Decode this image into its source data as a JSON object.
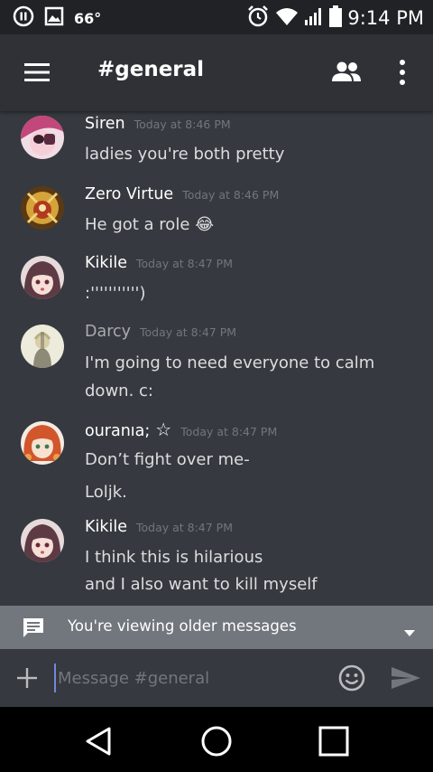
{
  "status_bar": {
    "temperature": "66°",
    "time": "9:14 PM",
    "icons": [
      "pause-icon",
      "gallery-icon",
      "alarm-icon",
      "wifi-icon",
      "signal-icon",
      "battery-icon"
    ]
  },
  "header": {
    "channel_name": "#general",
    "icons": [
      "hamburger-menu-icon",
      "members-icon",
      "more-vertical-icon"
    ]
  },
  "messages": [
    {
      "author": "Siren",
      "timestamp": "Today at 8:46 PM",
      "lines": [
        "ladies you're both pretty"
      ]
    },
    {
      "author": "Zero Virtue",
      "timestamp": "Today at 8:46 PM",
      "lines": [
        "He got a role"
      ],
      "emoji": "😂"
    },
    {
      "author": "Kikile",
      "timestamp": "Today at 8:47 PM",
      "lines": [
        ":''''''''''')"
      ]
    },
    {
      "author": "Darcy",
      "timestamp": "Today at 8:47 PM",
      "lines": [
        "I'm going to need everyone to calm",
        "down. c:"
      ]
    },
    {
      "author": "ouranıa;",
      "author_suffix": "☆",
      "timestamp": "Today at 8:47 PM",
      "lines": [
        "Don’t fight over me-",
        "Loljk."
      ]
    },
    {
      "author": "Kikile",
      "timestamp": "Today at 8:47 PM",
      "lines": [
        "I think this is hilarious",
        "and I also want to kill myself"
      ]
    }
  ],
  "older_banner": {
    "text": "You're viewing older messages"
  },
  "composer": {
    "placeholder": "Message #general"
  },
  "colors": {
    "background": "#36393f",
    "header": "#2f3136",
    "status_bar": "#202225",
    "banner": "#72767d",
    "accent": "#7289da"
  }
}
